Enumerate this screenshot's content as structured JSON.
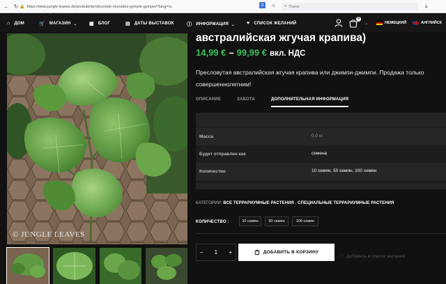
{
  "browser": {
    "url": "https://www.jungle-leaves.de/produkt/dendrocnide-moroides-gympie-gympie/?lang=ru",
    "search_placeholder": "Поиск"
  },
  "nav": {
    "items": [
      {
        "label": "ДОМ",
        "icon": "home-icon"
      },
      {
        "label": "МАГАЗИН",
        "icon": "cart-icon",
        "dropdown": true
      },
      {
        "label": "БЛОГ",
        "icon": "blog-icon"
      },
      {
        "label": "ДАТЫ ВЫСТАВОК",
        "icon": "calendar-icon"
      },
      {
        "label": "ИНФОРМАЦИЯ",
        "icon": "info-icon",
        "dropdown": true
      },
      {
        "label": "СПИСОК ЖЕЛАНИЙ",
        "icon": "heart-icon"
      }
    ],
    "cart_count": "0",
    "languages": [
      {
        "label": "НЕМЕЦКИЙ",
        "flag": "de"
      },
      {
        "label": "АНГЛИЙСК",
        "flag": "gb"
      }
    ]
  },
  "product": {
    "title": "австралийская жгучая крапива)",
    "price_from": "14,99 €",
    "price_dash": "–",
    "price_to": "99,99 €",
    "vat": "вкл. НДС",
    "description": "Пресловутая австралийская жгучая крапива или джимпи-джимпи. Продажа только совершеннолетним!",
    "watermark": "© JUNGLE LEAVES",
    "tabs": [
      {
        "label": "ОПИСАНИЕ",
        "active": false
      },
      {
        "label": "ЗАБОТА",
        "active": false
      },
      {
        "label": "ДОПОЛНИТЕЛЬНАЯ ИНФОРМАЦИЯ",
        "active": true
      }
    ],
    "attributes": [
      {
        "key": "Масса",
        "value": "0,0 кг"
      },
      {
        "key": "Будет отправлен как",
        "value": "семена"
      },
      {
        "key": "Количество",
        "value": "10 семян, 50 семян, 100 семян"
      }
    ],
    "categories_label": "КАТЕГОРИИ:",
    "categories": [
      "ВСЕ ТЕРРАРИУМНЫЕ РАСТЕНИЯ",
      "СПЕЦИАЛЬНЫЕ ТЕРРАРИУМНЫЕ РАСТЕНИЯ"
    ],
    "categories_sep": " , ",
    "quantity_label": "КОЛИЧЕСТВО :",
    "quantity_options": [
      "10 семян",
      "50 семян",
      "100 семян"
    ],
    "stepper": {
      "minus": "–",
      "value": "1",
      "plus": "+"
    },
    "add_to_cart": "ДОБАВИТЬ В КОРЗИНУ",
    "wishlist": "Добавить в список желаний"
  },
  "colors": {
    "price": "#3fbd5e",
    "background": "#111111"
  }
}
